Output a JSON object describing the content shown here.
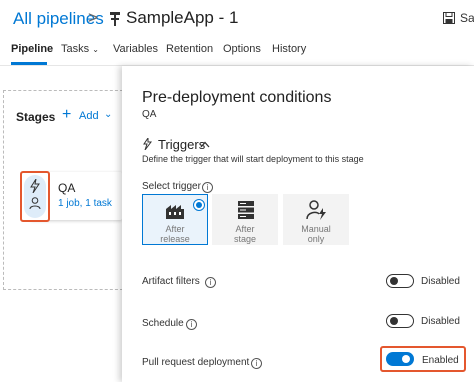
{
  "header": {
    "breadcrumb_link": "All pipelines",
    "separator": ">",
    "pipeline_name": "SampleApp - 1",
    "save_label": "Save"
  },
  "tabs": [
    {
      "label": "Pipeline",
      "active": true
    },
    {
      "label": "Tasks"
    },
    {
      "label": "Variables"
    },
    {
      "label": "Retention"
    },
    {
      "label": "Options"
    },
    {
      "label": "History"
    }
  ],
  "canvas": {
    "stages_label": "Stages",
    "add_plus": "+",
    "add_label": "Add",
    "stage": {
      "name": "QA",
      "subtitle": "1 job, 1 task"
    }
  },
  "panel": {
    "title": "Pre-deployment conditions",
    "subtitle": "QA",
    "triggers": {
      "title": "Triggers",
      "description": "Define the trigger that will start deployment to this stage",
      "select_label": "Select trigger",
      "options": [
        {
          "line1": "After",
          "line2": "release",
          "selected": true
        },
        {
          "line1": "After",
          "line2": "stage",
          "selected": false
        },
        {
          "line1": "Manual",
          "line2": "only",
          "selected": false
        }
      ]
    },
    "rows": [
      {
        "label": "Artifact filters",
        "state": "Disabled",
        "on": false
      },
      {
        "label": "Schedule",
        "state": "Disabled",
        "on": false
      },
      {
        "label": "Pull request deployment",
        "state": "Enabled",
        "on": true
      }
    ]
  },
  "colors": {
    "accent": "#0078d4",
    "highlight": "#e4572e"
  }
}
